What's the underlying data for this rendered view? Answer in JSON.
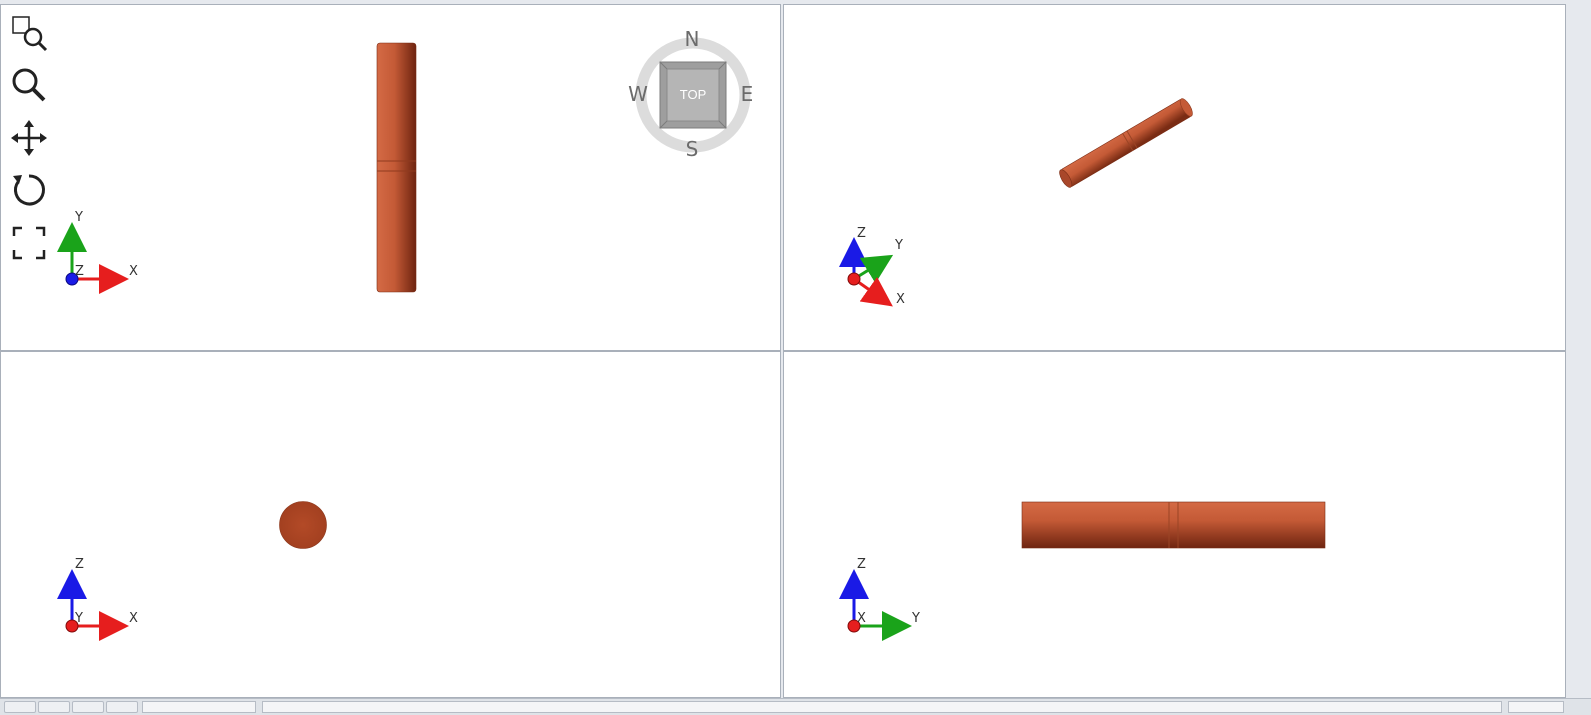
{
  "colors": {
    "cylinder_light": "#d46a45",
    "cylinder_mid": "#b9512f",
    "cylinder_dark": "#6e2410",
    "axis_x": "#e61e1e",
    "axis_y": "#1aa31a",
    "axis_z": "#1a1ae6",
    "compass_ring": "#dcdcdc",
    "compass_face": "#b5b5b5"
  },
  "toolbar": {
    "zoom_box_icon": "zoom-box-icon",
    "zoom_icon": "zoom-icon",
    "pan_icon": "pan-icon",
    "rotate_icon": "rotate-icon",
    "fit_icon": "fit-icon"
  },
  "compass": {
    "north": "N",
    "south": "S",
    "east": "E",
    "west": "W",
    "face": "TOP"
  },
  "viewports": {
    "top": {
      "triad": {
        "x": "X",
        "y": "Y",
        "z": "Z"
      }
    },
    "iso": {
      "triad": {
        "x": "X",
        "y": "Y",
        "z": "Z"
      }
    },
    "front": {
      "triad": {
        "x": "X",
        "y": "Y",
        "z": "Z"
      }
    },
    "side": {
      "triad": {
        "x": "X",
        "y": "Y",
        "z": "Z"
      }
    }
  }
}
